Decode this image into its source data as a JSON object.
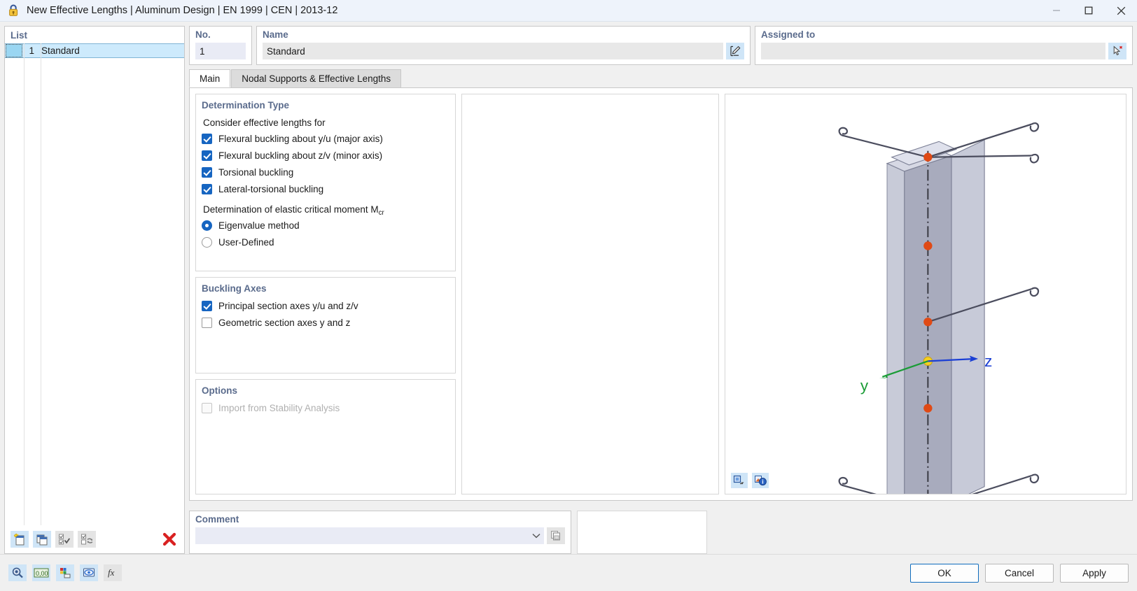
{
  "window": {
    "title": "New Effective Lengths | Aluminum Design | EN 1999 | CEN | 2013-12",
    "app_icon": "padlock-icon",
    "minimize_label": "—",
    "maximize_label": "☐",
    "close_label": "✕"
  },
  "list_panel": {
    "caption": "List",
    "rows": [
      {
        "no": "1",
        "name": "Standard",
        "selected": true
      }
    ],
    "toolbar": [
      {
        "name": "new-item-button",
        "icon": "new-document-icon"
      },
      {
        "name": "duplicate-item-button",
        "icon": "copy-icon"
      },
      {
        "name": "select-all-button",
        "icon": "check-all-icon"
      },
      {
        "name": "invert-selection-button",
        "icon": "invert-selection-icon"
      },
      {
        "name": "delete-item-button",
        "icon": "red-x-icon"
      }
    ]
  },
  "no_field": {
    "caption": "No.",
    "value": "1"
  },
  "name_field": {
    "caption": "Name",
    "value": "Standard",
    "placeholder": "",
    "edit_button_icon": "rename-icon"
  },
  "assigned_field": {
    "caption": "Assigned to",
    "value": "",
    "placeholder": "",
    "clear_button_icon": "select-objects-icon"
  },
  "tabs": [
    {
      "label": "Main",
      "active": true
    },
    {
      "label": "Nodal Supports & Effective Lengths",
      "active": false
    }
  ],
  "determination_type": {
    "caption": "Determination Type",
    "sub_label": "Consider effective lengths for",
    "checkboxes": [
      {
        "label": "Flexural buckling about y/u (major axis)",
        "checked": true,
        "disabled": false
      },
      {
        "label": "Flexural buckling about z/v (minor axis)",
        "checked": true,
        "disabled": false
      },
      {
        "label": "Torsional buckling",
        "checked": true,
        "disabled": false
      },
      {
        "label": "Lateral-torsional buckling",
        "checked": true,
        "disabled": false
      }
    ],
    "moment_heading_prefix": "Determination of elastic critical moment M",
    "moment_heading_sub": "cr",
    "radios": [
      {
        "label": "Eigenvalue method",
        "selected": true
      },
      {
        "label": "User-Defined",
        "selected": false
      }
    ]
  },
  "buckling_axes": {
    "caption": "Buckling Axes",
    "checkboxes": [
      {
        "label": "Principal section axes y/u and z/v",
        "checked": true,
        "disabled": false
      },
      {
        "label": "Geometric section axes y and z",
        "checked": false,
        "disabled": false
      }
    ]
  },
  "options": {
    "caption": "Options",
    "checkboxes": [
      {
        "label": "Import from Stability Analysis",
        "checked": false,
        "disabled": true
      }
    ]
  },
  "comment": {
    "caption": "Comment",
    "value": "",
    "placeholder": "",
    "dropdown_icon": "chevron-down-icon",
    "copy_button_icon": "copy-comment-icon"
  },
  "view3d": {
    "axis_y_label": "y",
    "axis_z_label": "z",
    "axis_y_color": "#1a9c36",
    "axis_z_color": "#1b3fd4",
    "node_color": "#e04a15",
    "origin_color": "#f5d020",
    "member_color": "#a8abbd",
    "toolbar": [
      {
        "name": "view-render-button",
        "icon": "render-mode-icon"
      },
      {
        "name": "view-info-button",
        "icon": "info-icon"
      }
    ]
  },
  "footer": {
    "tools": [
      {
        "name": "units-button",
        "icon": "magnifier-units-icon"
      },
      {
        "name": "decimal-places-button",
        "icon": "decimal-places-icon"
      },
      {
        "name": "settings-button",
        "icon": "color-settings-icon"
      },
      {
        "name": "view-settings-button",
        "icon": "display-settings-icon"
      },
      {
        "name": "formula-button",
        "icon": "fx-icon"
      }
    ],
    "buttons": [
      {
        "label": "OK",
        "default": true
      },
      {
        "label": "Cancel",
        "default": false
      },
      {
        "label": "Apply",
        "default": false
      }
    ]
  },
  "colors": {
    "accent": "#1665c1",
    "caption": "#5a6b8c",
    "titlebar": "#eef3fb",
    "selection": "#cdeafc",
    "danger": "#d92121"
  }
}
